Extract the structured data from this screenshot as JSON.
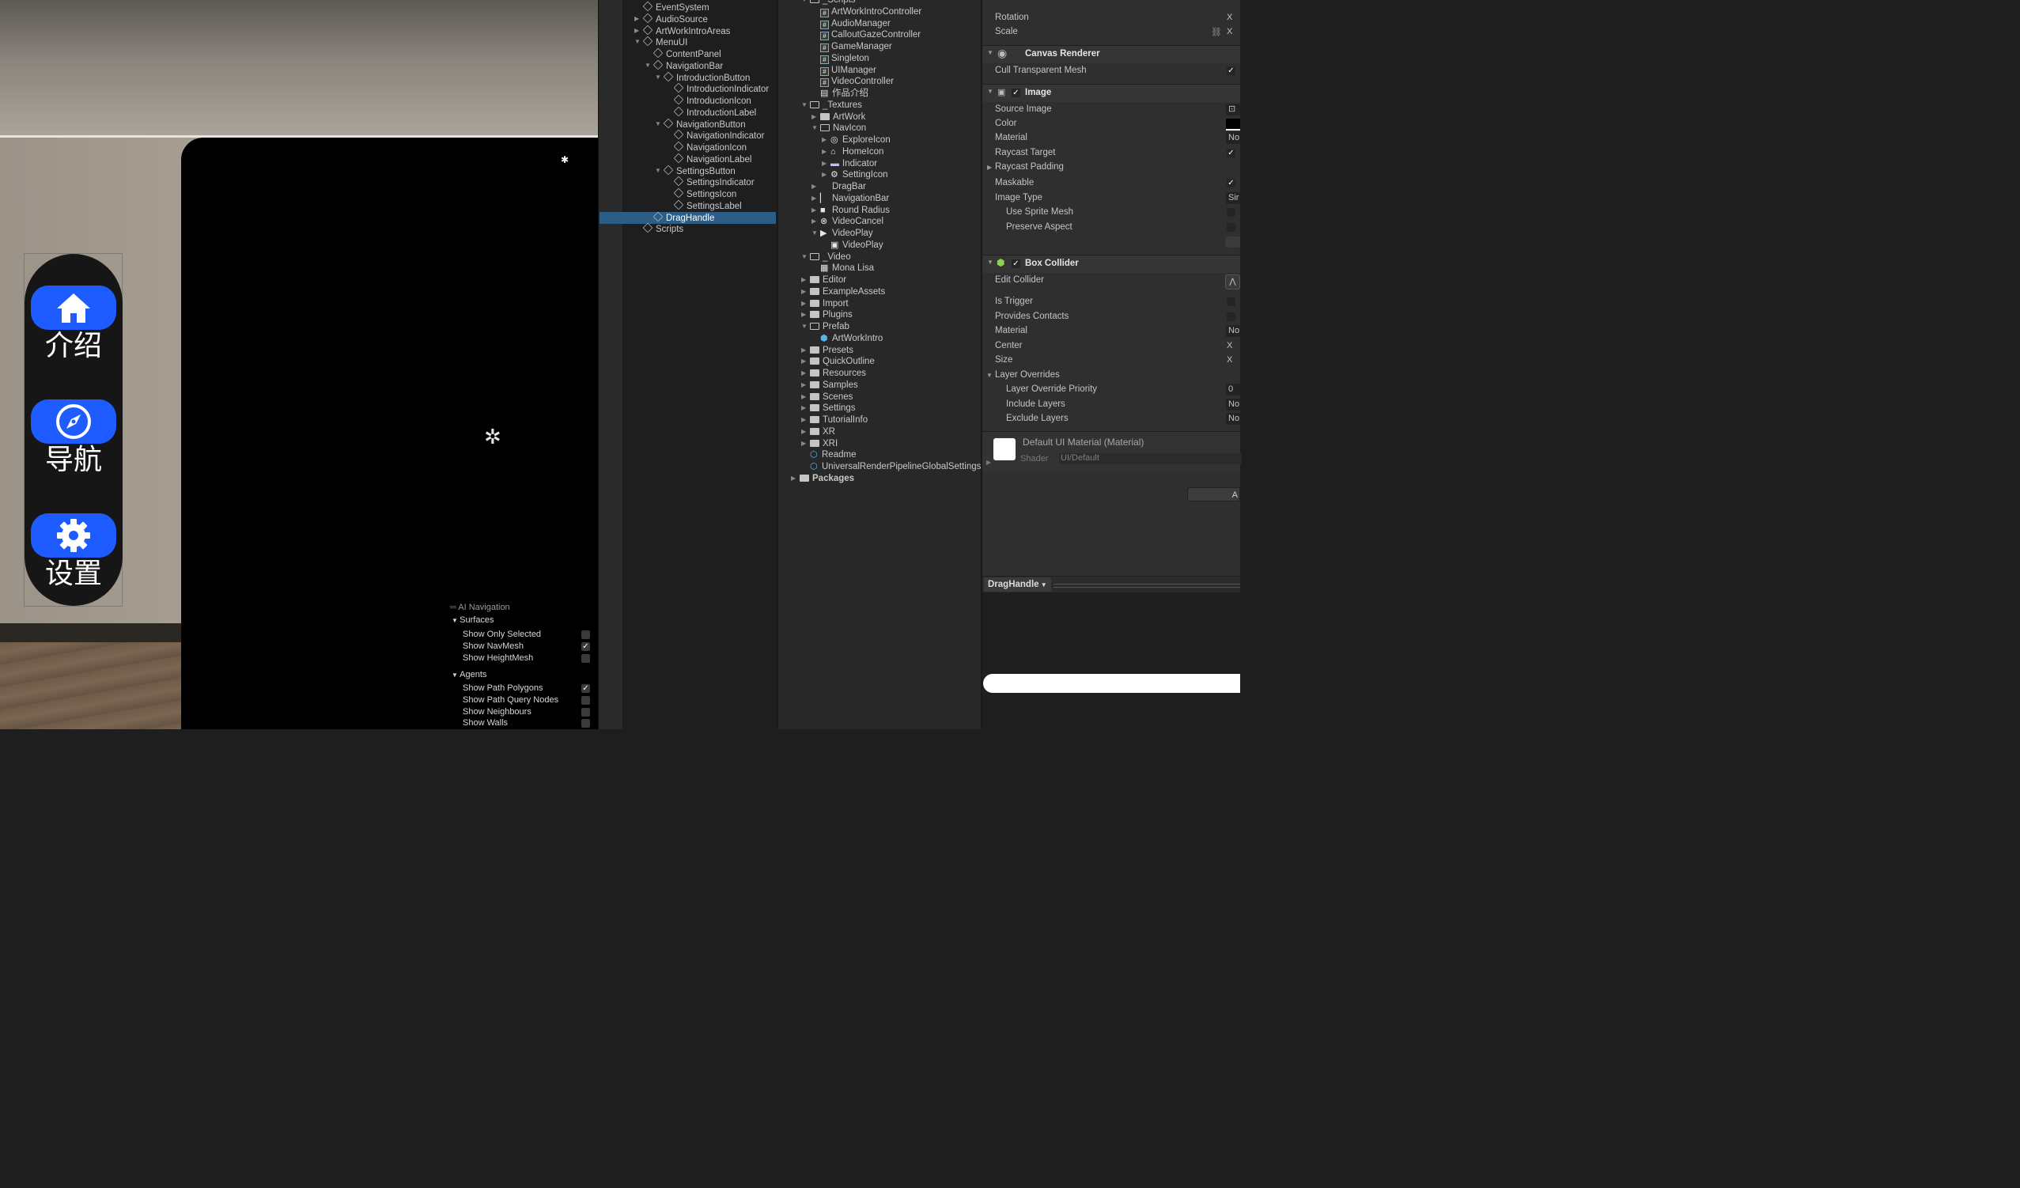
{
  "scene": {
    "navbar": {
      "buttons": [
        {
          "icon": "home-icon",
          "label": "介绍"
        },
        {
          "icon": "compass-icon",
          "label": "导航"
        },
        {
          "icon": "gear-icon",
          "label": "设置"
        }
      ],
      "accent": "#1e5cff"
    },
    "ai_navigation": {
      "title": "AI Navigation",
      "surfaces_label": "Surfaces",
      "surfaces": [
        {
          "label": "Show Only Selected",
          "checked": false
        },
        {
          "label": "Show NavMesh",
          "checked": true
        },
        {
          "label": "Show HeightMesh",
          "checked": false
        }
      ],
      "agents_label": "Agents",
      "agents": [
        {
          "label": "Show Path Polygons",
          "checked": true
        },
        {
          "label": "Show Path Query Nodes",
          "checked": false
        },
        {
          "label": "Show Neighbours",
          "checked": false
        },
        {
          "label": "Show Walls",
          "checked": false
        }
      ]
    }
  },
  "hierarchy": {
    "items": [
      {
        "label": "EventSystem",
        "depth": 0,
        "caret": ""
      },
      {
        "label": "AudioSource",
        "depth": 0,
        "caret": "▶"
      },
      {
        "label": "ArtWorkIntroAreas",
        "depth": 0,
        "caret": "▶"
      },
      {
        "label": "MenuUI",
        "depth": 0,
        "caret": "▼"
      },
      {
        "label": "ContentPanel",
        "depth": 1,
        "caret": ""
      },
      {
        "label": "NavigationBar",
        "depth": 1,
        "caret": "▼"
      },
      {
        "label": "IntroductionButton",
        "depth": 2,
        "caret": "▼"
      },
      {
        "label": "IntroductionIndicator",
        "depth": 3,
        "caret": ""
      },
      {
        "label": "IntroductionIcon",
        "depth": 3,
        "caret": ""
      },
      {
        "label": "IntroductionLabel",
        "depth": 3,
        "caret": ""
      },
      {
        "label": "NavigationButton",
        "depth": 2,
        "caret": "▼"
      },
      {
        "label": "NavigationIndicator",
        "depth": 3,
        "caret": ""
      },
      {
        "label": "NavigationIcon",
        "depth": 3,
        "caret": ""
      },
      {
        "label": "NavigationLabel",
        "depth": 3,
        "caret": ""
      },
      {
        "label": "SettingsButton",
        "depth": 2,
        "caret": "▼"
      },
      {
        "label": "SettingsIndicator",
        "depth": 3,
        "caret": ""
      },
      {
        "label": "SettingsIcon",
        "depth": 3,
        "caret": ""
      },
      {
        "label": "SettingsLabel",
        "depth": 3,
        "caret": ""
      },
      {
        "label": "DragHandle",
        "depth": 1,
        "caret": "",
        "selected": true
      },
      {
        "label": "Scripts",
        "depth": 0,
        "caret": ""
      }
    ]
  },
  "project": {
    "items": [
      {
        "label": "_Scripts",
        "depth": 1,
        "type": "folder-open",
        "caret": "▼"
      },
      {
        "label": "ArtWorkIntroController",
        "depth": 2,
        "type": "script"
      },
      {
        "label": "AudioManager",
        "depth": 2,
        "type": "script"
      },
      {
        "label": "CalloutGazeController",
        "depth": 2,
        "type": "script"
      },
      {
        "label": "GameManager",
        "depth": 2,
        "type": "script"
      },
      {
        "label": "Singleton",
        "depth": 2,
        "type": "script"
      },
      {
        "label": "UIManager",
        "depth": 2,
        "type": "script"
      },
      {
        "label": "VideoController",
        "depth": 2,
        "type": "script"
      },
      {
        "label": "作品介绍",
        "depth": 2,
        "type": "doc"
      },
      {
        "label": "_Textures",
        "depth": 1,
        "type": "folder-open",
        "caret": "▼"
      },
      {
        "label": "ArtWork",
        "depth": 2,
        "type": "folder",
        "caret": "▶"
      },
      {
        "label": "NavIcon",
        "depth": 2,
        "type": "folder-open",
        "caret": "▼"
      },
      {
        "label": "ExploreIcon",
        "depth": 3,
        "type": "compass",
        "caret": "▶"
      },
      {
        "label": "HomeIcon",
        "depth": 3,
        "type": "home",
        "caret": "▶"
      },
      {
        "label": "Indicator",
        "depth": 3,
        "type": "pill",
        "caret": "▶"
      },
      {
        "label": "SettingIcon",
        "depth": 3,
        "type": "gear",
        "caret": "▶"
      },
      {
        "label": "DragBar",
        "depth": 2,
        "type": "blank",
        "caret": "▶"
      },
      {
        "label": "NavigationBar",
        "depth": 2,
        "type": "bar",
        "caret": "▶"
      },
      {
        "label": "Round Radius",
        "depth": 2,
        "type": "square",
        "caret": "▶"
      },
      {
        "label": "VideoCancel",
        "depth": 2,
        "type": "cancel",
        "caret": "▶"
      },
      {
        "label": "VideoPlay",
        "depth": 2,
        "type": "play",
        "caret": "▼"
      },
      {
        "label": "VideoPlay",
        "depth": 3,
        "type": "sprite"
      },
      {
        "label": "_Video",
        "depth": 1,
        "type": "folder-open",
        "caret": "▼"
      },
      {
        "label": "Mona Lisa",
        "depth": 2,
        "type": "video"
      },
      {
        "label": "Editor",
        "depth": 1,
        "type": "folder",
        "caret": "▶"
      },
      {
        "label": "ExampleAssets",
        "depth": 1,
        "type": "folder",
        "caret": "▶"
      },
      {
        "label": "Import",
        "depth": 1,
        "type": "folder",
        "caret": "▶"
      },
      {
        "label": "Plugins",
        "depth": 1,
        "type": "folder",
        "caret": "▶"
      },
      {
        "label": "Prefab",
        "depth": 1,
        "type": "folder-open",
        "caret": "▼"
      },
      {
        "label": "ArtWorkIntro",
        "depth": 2,
        "type": "prefab"
      },
      {
        "label": "Presets",
        "depth": 1,
        "type": "folder",
        "caret": "▶"
      },
      {
        "label": "QuickOutline",
        "depth": 1,
        "type": "folder",
        "caret": "▶"
      },
      {
        "label": "Resources",
        "depth": 1,
        "type": "folder",
        "caret": "▶"
      },
      {
        "label": "Samples",
        "depth": 1,
        "type": "folder",
        "caret": "▶"
      },
      {
        "label": "Scenes",
        "depth": 1,
        "type": "folder",
        "caret": "▶"
      },
      {
        "label": "Settings",
        "depth": 1,
        "type": "folder",
        "caret": "▶"
      },
      {
        "label": "TutorialInfo",
        "depth": 1,
        "type": "folder",
        "caret": "▶"
      },
      {
        "label": "XR",
        "depth": 1,
        "type": "folder",
        "caret": "▶"
      },
      {
        "label": "XRI",
        "depth": 1,
        "type": "folder",
        "caret": "▶"
      },
      {
        "label": "Readme",
        "depth": 1,
        "type": "asset"
      },
      {
        "label": "UniversalRenderPipelineGlobalSettings",
        "depth": 1,
        "type": "asset"
      },
      {
        "label": "Packages",
        "depth": 0,
        "type": "folder",
        "caret": "▶"
      }
    ]
  },
  "inspector": {
    "transform": {
      "rotation": "Rotation",
      "scale": "Scale",
      "axis_x": "X"
    },
    "canvas_renderer": {
      "title": "Canvas Renderer",
      "cull": "Cull Transparent Mesh"
    },
    "image": {
      "title": "Image",
      "source_image": "Source Image",
      "color": "Color",
      "material": "Material",
      "material_value": "No",
      "raycast_target": "Raycast Target",
      "raycast_padding": "Raycast Padding",
      "maskable": "Maskable",
      "image_type": "Image Type",
      "image_type_value": "Sir",
      "use_sprite_mesh": "Use Sprite Mesh",
      "preserve_aspect": "Preserve Aspect"
    },
    "box_collider": {
      "title": "Box Collider",
      "edit_collider": "Edit Collider",
      "is_trigger": "Is Trigger",
      "provides_contacts": "Provides Contacts",
      "material": "Material",
      "material_value": "No",
      "center": "Center",
      "size": "Size",
      "layer_overrides": "Layer Overrides",
      "layer_override_priority": "Layer Override Priority",
      "layer_override_priority_value": "0",
      "include_layers": "Include Layers",
      "include_layers_value": "No",
      "exclude_layers": "Exclude Layers",
      "exclude_layers_value": "No"
    },
    "material_block": {
      "name": "Default UI Material (Material)",
      "shader_label": "Shader",
      "shader_value": "UI/Default"
    },
    "add_component_fragment": "A",
    "preview_object": "DragHandle"
  }
}
